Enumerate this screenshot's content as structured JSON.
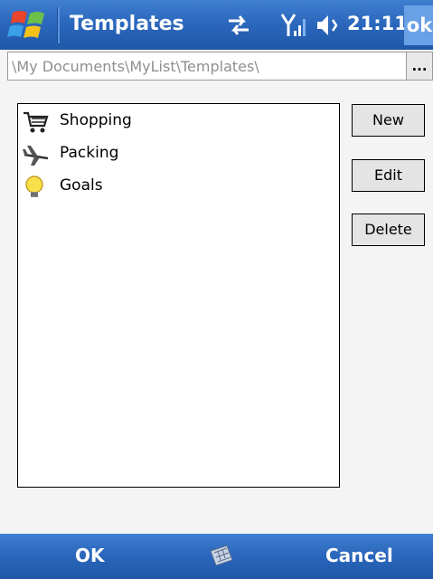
{
  "titlebar": {
    "title": "Templates",
    "clock": "21:11",
    "ok_label": "ok",
    "icons": [
      "windows-start-icon",
      "sync-icon",
      "signal-icon",
      "volume-icon"
    ]
  },
  "path": {
    "value": "\\My Documents\\MyList\\Templates\\",
    "browse_label": "..."
  },
  "templates": [
    {
      "label": "Shopping",
      "icon": "shopping-cart-icon"
    },
    {
      "label": "Packing",
      "icon": "airplane-icon"
    },
    {
      "label": "Goals",
      "icon": "lightbulb-icon"
    }
  ],
  "actions": {
    "new_label": "New",
    "edit_label": "Edit",
    "delete_label": "Delete"
  },
  "softkeys": {
    "left": "OK",
    "right": "Cancel",
    "center_icon": "keyboard-icon"
  },
  "colors": {
    "titlebar": "#2a66bb",
    "ok_highlight": "#6aa0e6"
  }
}
